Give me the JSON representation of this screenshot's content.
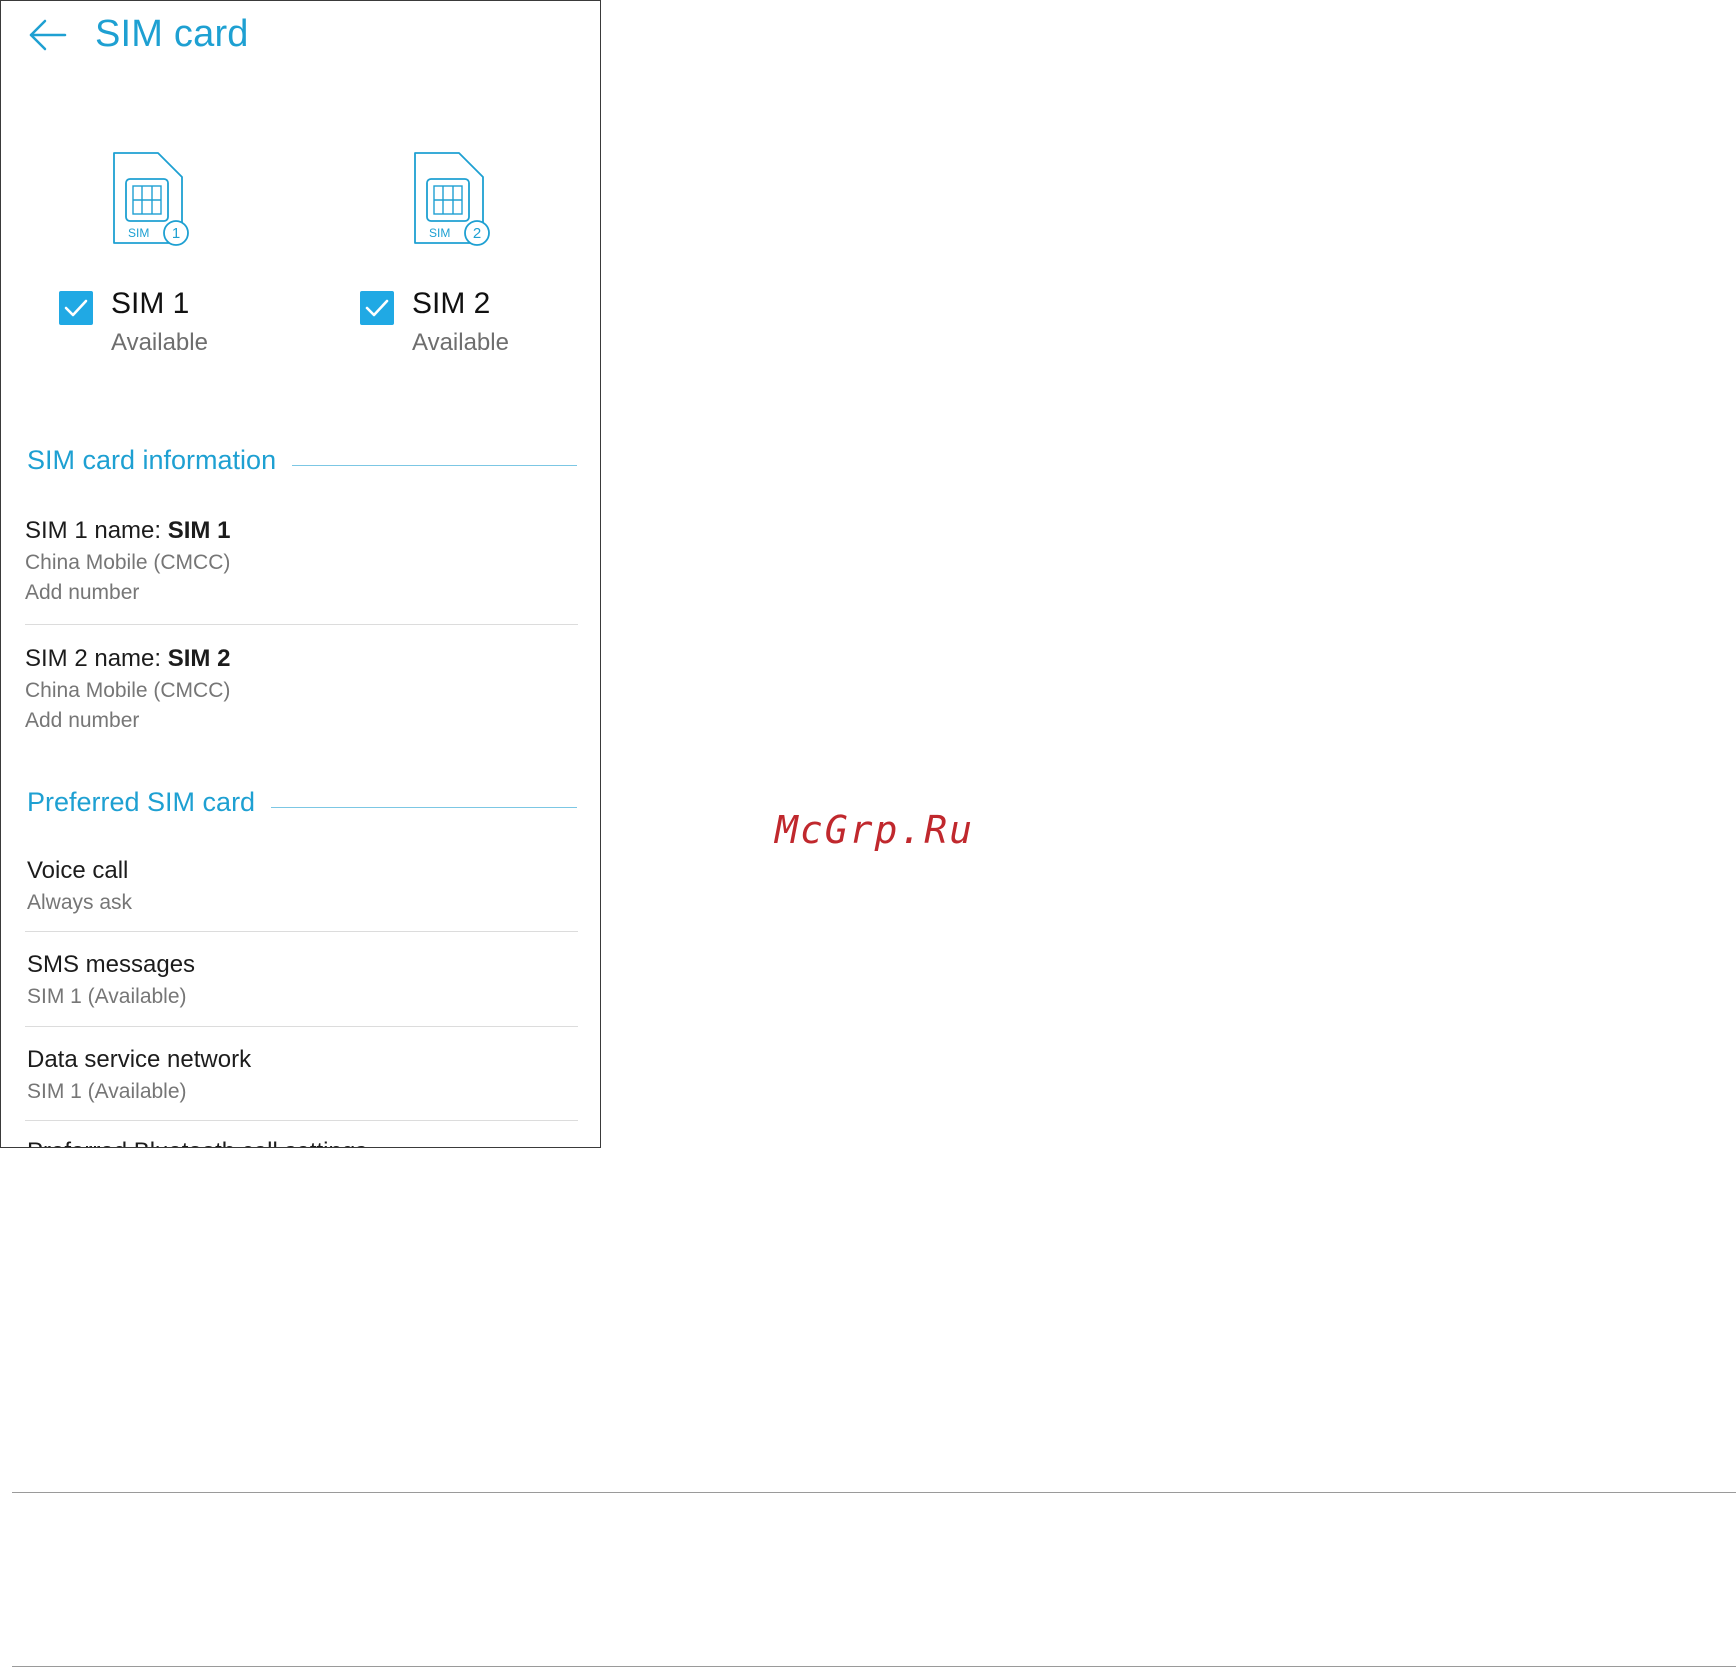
{
  "header": {
    "title": "SIM card"
  },
  "sims": [
    {
      "name": "SIM 1",
      "status": "Available",
      "checked": true,
      "icon_label": "SIM",
      "icon_number": "1"
    },
    {
      "name": "SIM 2",
      "status": "Available",
      "checked": true,
      "icon_label": "SIM",
      "icon_number": "2"
    }
  ],
  "sim_info": {
    "header": "SIM card information",
    "items": [
      {
        "title_prefix": "SIM 1 name: ",
        "title_name": "SIM 1",
        "carrier": "China Mobile (CMCC)",
        "number": "Add number"
      },
      {
        "title_prefix": "SIM 2 name: ",
        "title_name": "SIM 2",
        "carrier": "China Mobile (CMCC)",
        "number": "Add number"
      }
    ]
  },
  "preferred": {
    "header": "Preferred SIM card",
    "items": [
      {
        "title": "Voice call",
        "value": "Always ask"
      },
      {
        "title": "SMS messages",
        "value": "SIM 1 (Available)"
      },
      {
        "title": "Data service network",
        "value": "SIM 1 (Available)"
      },
      {
        "title": "Preferred Bluetooth call settings",
        "value": ""
      }
    ]
  },
  "watermark": "McGrp.Ru",
  "colors": {
    "accent": "#1ea0d2",
    "checkbox": "#20a9e4",
    "watermark": "#c0282d"
  },
  "icons": {
    "back": "arrow-left-icon",
    "sim": "sim-card-icon",
    "check": "checkmark-icon"
  }
}
